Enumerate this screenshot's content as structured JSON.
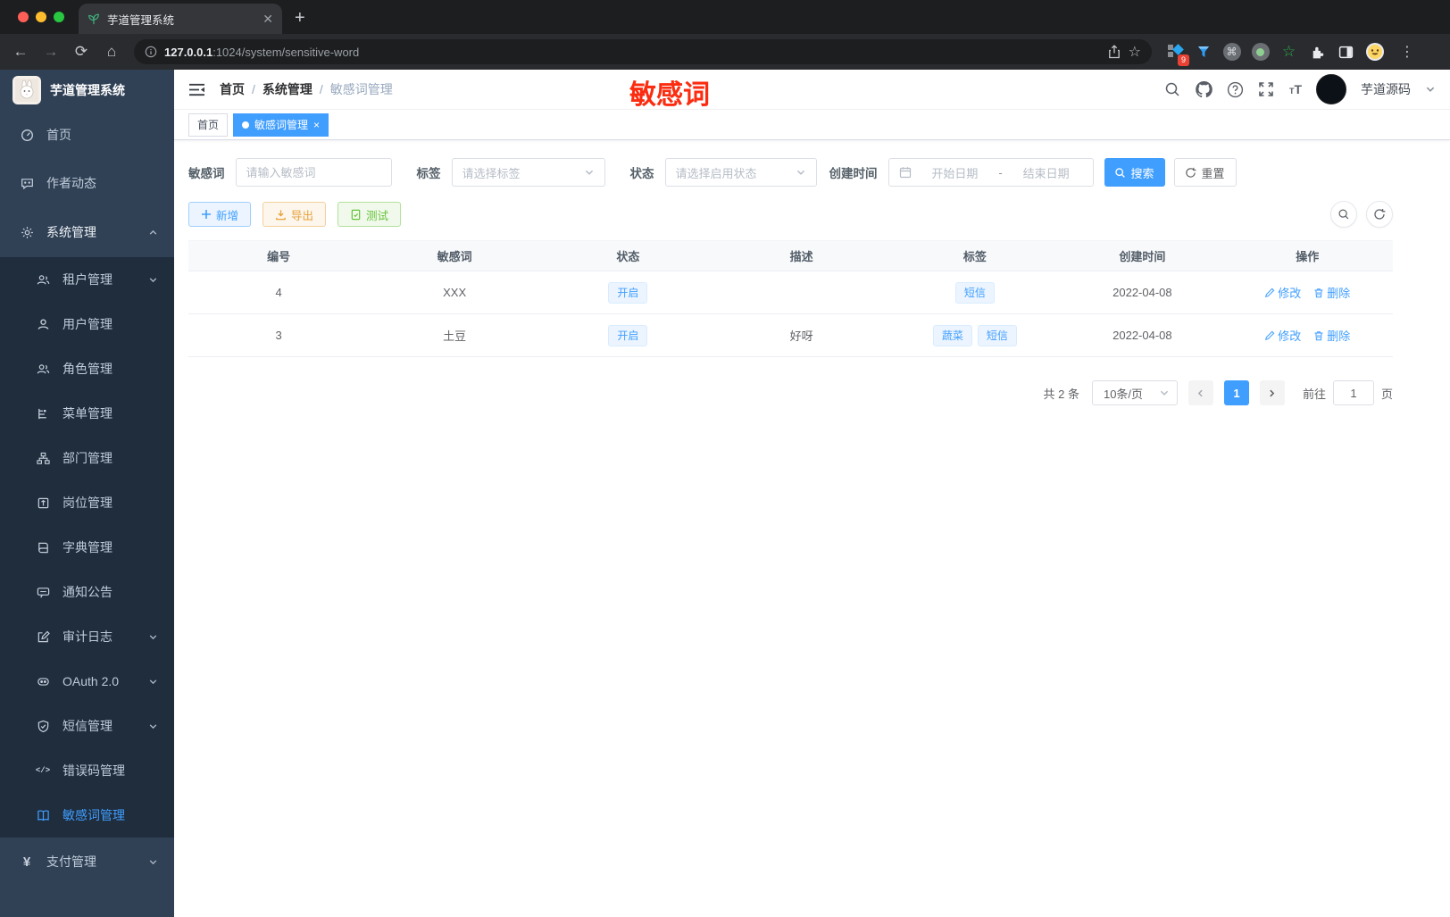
{
  "browser": {
    "tab_title": "芋道管理系统",
    "url_host": "127.0.0.1",
    "url_path": ":1024/system/sensitive-word",
    "extension_badge": "9"
  },
  "sidebar": {
    "logo_title": "芋道管理系统",
    "items": [
      {
        "label": "首页",
        "icon": "dashboard-icon"
      },
      {
        "label": "作者动态",
        "icon": "chat-icon"
      },
      {
        "label": "系统管理",
        "icon": "gear-icon"
      },
      {
        "label": "租户管理",
        "icon": "tenant-icon"
      },
      {
        "label": "用户管理",
        "icon": "user-icon"
      },
      {
        "label": "角色管理",
        "icon": "role-icon"
      },
      {
        "label": "菜单管理",
        "icon": "menu-tree-icon"
      },
      {
        "label": "部门管理",
        "icon": "department-icon"
      },
      {
        "label": "岗位管理",
        "icon": "post-icon"
      },
      {
        "label": "字典管理",
        "icon": "dictionary-icon"
      },
      {
        "label": "通知公告",
        "icon": "notice-icon"
      },
      {
        "label": "审计日志",
        "icon": "audit-log-icon"
      },
      {
        "label": "OAuth 2.0",
        "icon": "oauth-icon"
      },
      {
        "label": "短信管理",
        "icon": "sms-icon"
      },
      {
        "label": "错误码管理",
        "icon": "error-code-icon"
      },
      {
        "label": "敏感词管理",
        "icon": "sensitive-word-icon"
      },
      {
        "label": "支付管理",
        "icon": "payment-icon"
      }
    ]
  },
  "navbar": {
    "breadcrumb": [
      "首页",
      "系统管理",
      "敏感词管理"
    ],
    "separator": "/",
    "annotation": "敏感词",
    "username": "芋道源码"
  },
  "tags": {
    "items": [
      {
        "label": "首页"
      },
      {
        "label": "敏感词管理"
      }
    ]
  },
  "filters": {
    "keyword_label": "敏感词",
    "keyword_placeholder": "请输入敏感词",
    "tag_label": "标签",
    "tag_placeholder": "请选择标签",
    "status_label": "状态",
    "status_placeholder": "请选择启用状态",
    "date_label": "创建时间",
    "date_start_placeholder": "开始日期",
    "date_separator": "-",
    "date_end_placeholder": "结束日期",
    "search_label": "搜索",
    "reset_label": "重置"
  },
  "toolbar": {
    "add_label": "新增",
    "export_label": "导出",
    "test_label": "测试"
  },
  "table": {
    "headers": [
      "编号",
      "敏感词",
      "状态",
      "描述",
      "标签",
      "创建时间",
      "操作"
    ],
    "rows": [
      {
        "id": "4",
        "word": "XXX",
        "status": "开启",
        "description": "",
        "tags": [
          "短信"
        ],
        "created": "2022-04-08"
      },
      {
        "id": "3",
        "word": "土豆",
        "status": "开启",
        "description": "好呀",
        "tags": [
          "蔬菜",
          "短信"
        ],
        "created": "2022-04-08"
      }
    ],
    "edit_label": "修改",
    "delete_label": "删除"
  },
  "pagination": {
    "total": "共 2 条",
    "page_size": "10条/页",
    "current_page": "1",
    "goto_label": "前往",
    "goto_value": "1",
    "page_label": "页"
  },
  "colors": {
    "accent": "#409eff",
    "annotation_red": "#fb2c10",
    "sidebar_bg": "#304156",
    "submenu_bg": "#1f2d3d",
    "chip_bg": "#ecf5ff",
    "chip_border": "#d9ecff",
    "warning": "#e6a23c",
    "success": "#67c23a"
  }
}
